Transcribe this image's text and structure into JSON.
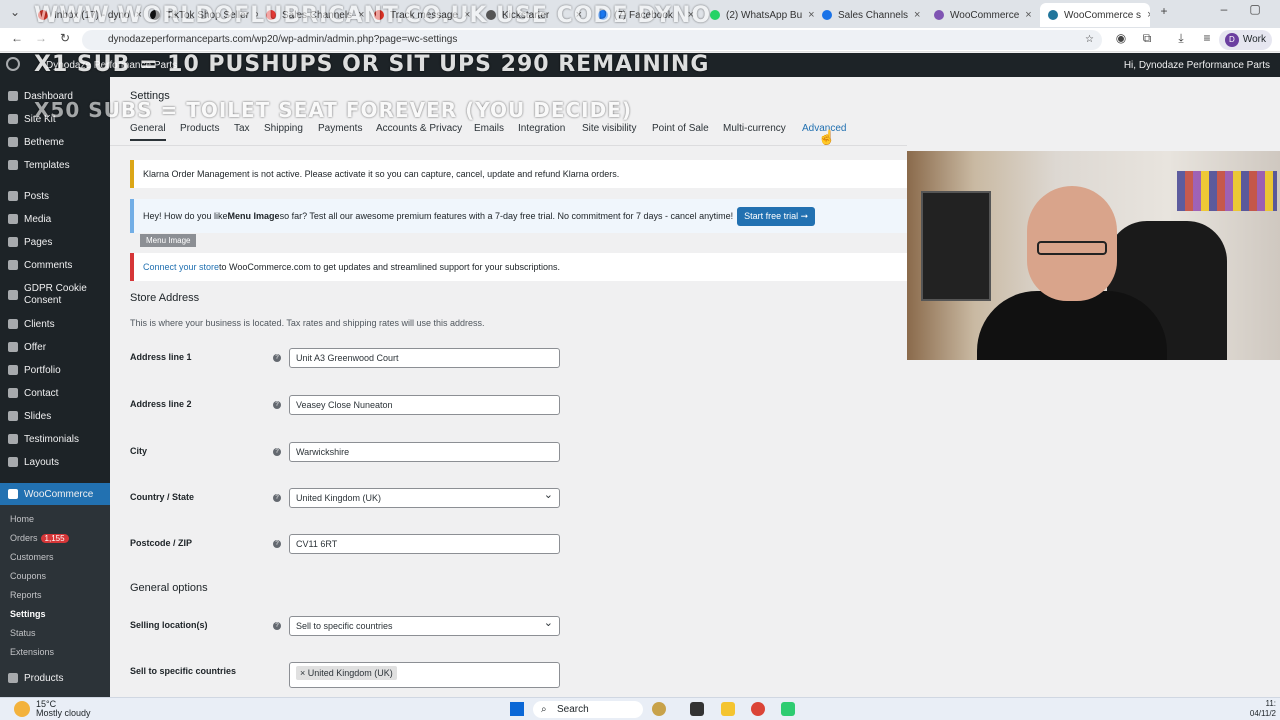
{
  "browser": {
    "tabs": [
      {
        "label": "Inbox (17) - dyno",
        "icon": "gmail-icon",
        "color": "#d93025"
      },
      {
        "label": "TikTok Shop Seller",
        "icon": "tiktok-icon",
        "color": "#111111"
      },
      {
        "label": "Sales Channels",
        "icon": "channels-icon",
        "color": "#e53935"
      },
      {
        "label": "Track message",
        "icon": "gmail-icon",
        "color": "#d93025"
      },
      {
        "label": "Kickstarter",
        "icon": "app-icon",
        "color": "#555555"
      },
      {
        "label": "(7) Facebook",
        "icon": "facebook-icon",
        "color": "#1877f2"
      },
      {
        "label": "(2) WhatsApp Bu",
        "icon": "whatsapp-icon",
        "color": "#25d366"
      },
      {
        "label": "Sales Channels",
        "icon": "channels-icon",
        "color": "#1a73e8"
      },
      {
        "label": "WooCommerce",
        "icon": "woo-icon",
        "color": "#7f54b3"
      },
      {
        "label": "WooCommerce s",
        "icon": "wordpress-icon",
        "color": "#21759b"
      }
    ],
    "url": "dynodazeperformanceparts.com/wp20/wp-admin/admin.php?page=wc-settings",
    "profile": "Work",
    "profile_initial": "D"
  },
  "overlay": {
    "line1": "WWW.WORLDOFLUBRICANT.CO.UK USE CODE DYNO",
    "line2": "X1 SUB = 10 PUSHUPS OR SIT UPS 290 REMAINING",
    "line3": "X50 SUBS = TOILET SEAT FOREVER (YOU DECIDE)"
  },
  "adminbar": {
    "site": "Dynodaze Performance Parts",
    "greeting": "Hi, Dynodaze Performance Parts"
  },
  "sidebar": {
    "items": [
      {
        "label": "Dashboard",
        "icon": "dashboard-icon"
      },
      {
        "label": "Site Kit",
        "icon": "sitekit-icon"
      },
      {
        "label": "Betheme",
        "icon": "betheme-icon"
      },
      {
        "label": "Templates",
        "icon": "templates-icon"
      },
      {
        "label": "Posts",
        "icon": "pin-icon"
      },
      {
        "label": "Media",
        "icon": "media-icon"
      },
      {
        "label": "Pages",
        "icon": "pages-icon"
      },
      {
        "label": "Comments",
        "icon": "comments-icon"
      },
      {
        "label": "GDPR Cookie Consent",
        "icon": "cookie-icon"
      },
      {
        "label": "Clients",
        "icon": "clients-icon"
      },
      {
        "label": "Offer",
        "icon": "offer-icon"
      },
      {
        "label": "Portfolio",
        "icon": "portfolio-icon"
      },
      {
        "label": "Contact",
        "icon": "contact-icon"
      },
      {
        "label": "Slides",
        "icon": "slides-icon"
      },
      {
        "label": "Testimonials",
        "icon": "testimonials-icon"
      },
      {
        "label": "Layouts",
        "icon": "layouts-icon"
      }
    ],
    "woocommerce": "WooCommerce",
    "woo_sub": [
      "Home",
      "Orders",
      "Customers",
      "Coupons",
      "Reports",
      "Settings",
      "Status",
      "Extensions"
    ],
    "orders_badge": "1,155",
    "products": "Products"
  },
  "main": {
    "title": "Settings",
    "tabs": [
      "General",
      "Products",
      "Tax",
      "Shipping",
      "Payments",
      "Accounts & Privacy",
      "Emails",
      "Integration",
      "Site visibility",
      "Point of Sale",
      "Multi-currency",
      "Advanced"
    ],
    "notice_klarna": "Klarna Order Management is not active. Please activate it so you can capture, cancel, update and refund Klarna orders.",
    "notice_menu_pre": "Hey! How do you like ",
    "notice_menu_bold": "Menu Image",
    "notice_menu_post": " so far? Test all our awesome premium features with a 7-day free trial. No commitment for 7 days - cancel anytime!",
    "start_trial": "Start free trial ➞",
    "menu_image_tag": "Menu Image",
    "connect_link": "Connect your store",
    "connect_rest": " to WooCommerce.com to get updates and streamlined support for your subscriptions.",
    "store_address_heading": "Store Address",
    "store_address_desc": "This is where your business is located. Tax rates and shipping rates will use this address.",
    "fields": {
      "address1_label": "Address line 1",
      "address1_value": "Unit A3 Greenwood Court",
      "address2_label": "Address line 2",
      "address2_value": "Veasey Close Nuneaton",
      "city_label": "City",
      "city_value": "Warwickshire",
      "country_label": "Country / State",
      "country_value": "United Kingdom (UK)",
      "postcode_label": "Postcode / ZIP",
      "postcode_value": "CV11 6RT"
    },
    "general_options_heading": "General options",
    "selling_label": "Selling location(s)",
    "selling_value": "Sell to specific countries",
    "specific_label": "Sell to specific countries",
    "specific_chip": "× United Kingdom (UK)"
  },
  "taskbar": {
    "temp": "15°C",
    "weather": "Mostly cloudy",
    "search": "Search",
    "time": "11:",
    "date": "04/11/2"
  },
  "colors": {
    "wp_blue": "#2271b1",
    "admin_dark": "#1d2327",
    "notice_warning": "#dba617",
    "notice_error": "#d63638"
  }
}
